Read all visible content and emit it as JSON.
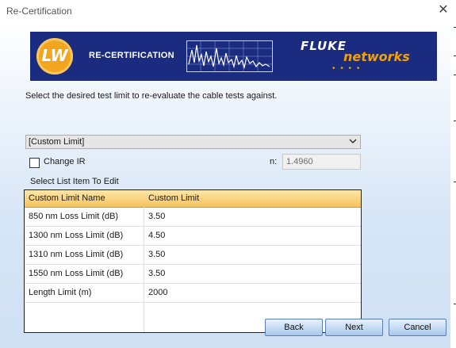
{
  "window": {
    "title": "Re-Certification",
    "close_icon": "close-icon"
  },
  "banner": {
    "logo_text": "LW",
    "heading": "RE-CERTIFICATION",
    "brand_primary": "FLUKE",
    "brand_secondary": "networks",
    "brand_dots": "• • • •",
    "colors": {
      "banner_bg": "#1b2b7f",
      "accent": "#f4a100"
    }
  },
  "instruction": "Select the desired test limit to re-evaluate the cable tests against.",
  "limit_select": {
    "selected": "[Custom Limit]"
  },
  "change_ir": {
    "label": "Change IR",
    "checked": false
  },
  "n_field": {
    "label": "n:",
    "value": "1.4960"
  },
  "list_caption": "Select List Item To Edit",
  "table": {
    "columns": [
      "Custom Limit Name",
      "Custom Limit"
    ],
    "rows": [
      {
        "name": "850 nm Loss Limit (dB)",
        "value": "3.50"
      },
      {
        "name": "1300 nm Loss Limit (dB)",
        "value": "4.50"
      },
      {
        "name": "1310 nm Loss Limit (dB)",
        "value": "3.50"
      },
      {
        "name": "1550 nm Loss Limit (dB)",
        "value": "3.50"
      },
      {
        "name": "Length Limit (m)",
        "value": "2000"
      }
    ]
  },
  "buttons": {
    "back": "Back",
    "next": "Next",
    "cancel": "Cancel"
  }
}
